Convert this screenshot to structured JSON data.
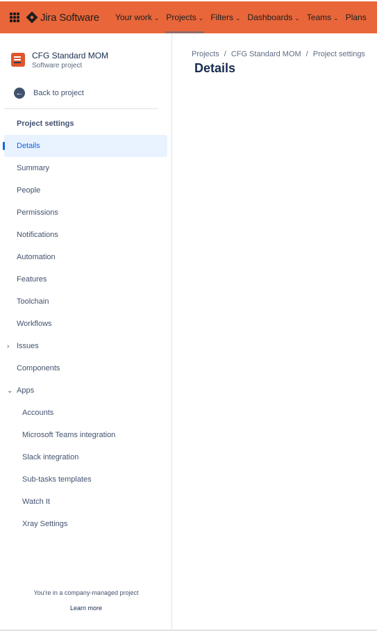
{
  "topbar": {
    "product_name": "Jira Software",
    "nav": [
      {
        "label": "Your work",
        "chevron": true
      },
      {
        "label": "Projects",
        "chevron": true,
        "active": true
      },
      {
        "label": "Filters",
        "chevron": true
      },
      {
        "label": "Dashboards",
        "chevron": true
      },
      {
        "label": "Teams",
        "chevron": true
      },
      {
        "label": "Plans",
        "chevron": false
      }
    ],
    "brand_color": "#e8663a"
  },
  "sidebar": {
    "project_name": "CFG Standard MOM",
    "project_type": "Software project",
    "back_label": "Back to project",
    "section_title": "Project settings",
    "items": [
      {
        "label": "Details",
        "selected": true
      },
      {
        "label": "Summary"
      },
      {
        "label": "People"
      },
      {
        "label": "Permissions"
      },
      {
        "label": "Notifications"
      },
      {
        "label": "Automation"
      },
      {
        "label": "Features"
      },
      {
        "label": "Toolchain"
      },
      {
        "label": "Workflows"
      },
      {
        "label": "Issues",
        "caret": "right"
      },
      {
        "label": "Components"
      },
      {
        "label": "Apps",
        "caret": "down"
      }
    ],
    "app_items": [
      {
        "label": "Accounts"
      },
      {
        "label": "Microsoft Teams integration"
      },
      {
        "label": "Slack integration"
      },
      {
        "label": "Sub-tasks templates"
      },
      {
        "label": "Watch It"
      },
      {
        "label": "Xray Settings"
      }
    ],
    "footer_note": "You're in a company-managed project",
    "footer_link": "Learn more"
  },
  "main": {
    "breadcrumb": [
      "Projects",
      "CFG Standard MOM",
      "Project settings"
    ],
    "title": "Details"
  }
}
